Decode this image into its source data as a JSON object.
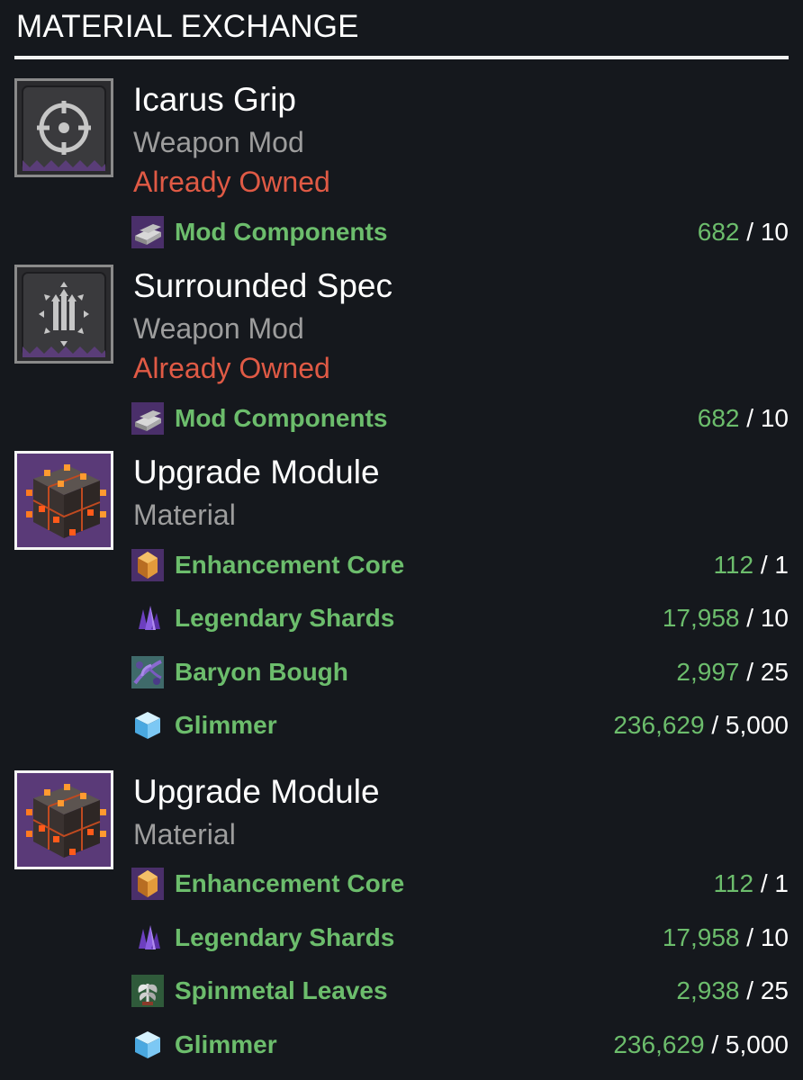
{
  "header": {
    "title": "MATERIAL EXCHANGE"
  },
  "items": [
    {
      "name": "Icarus Grip",
      "type": "Weapon Mod",
      "status": "Already Owned",
      "icon": "crosshair-mod-icon",
      "costs": [
        {
          "name": "Mod Components",
          "have": "682",
          "sep": " / ",
          "need": "10",
          "icon": "mod-components-icon"
        }
      ]
    },
    {
      "name": "Surrounded Spec",
      "type": "Weapon Mod",
      "status": "Already Owned",
      "icon": "surrounded-mod-icon",
      "costs": [
        {
          "name": "Mod Components",
          "have": "682",
          "sep": " / ",
          "need": "10",
          "icon": "mod-components-icon"
        }
      ]
    },
    {
      "name": "Upgrade Module",
      "type": "Material",
      "costs": [
        {
          "name": "Enhancement Core",
          "have": "112",
          "sep": " / ",
          "need": "1",
          "icon": "enhancement-core-icon"
        },
        {
          "name": "Legendary Shards",
          "have": "17,958",
          "sep": " / ",
          "need": "10",
          "icon": "legendary-shards-icon"
        },
        {
          "name": "Baryon Bough",
          "have": "2,997",
          "sep": " / ",
          "need": "25",
          "icon": "baryon-bough-icon"
        },
        {
          "name": "Glimmer",
          "have": "236,629",
          "sep": " / ",
          "need": "5,000",
          "icon": "glimmer-icon"
        }
      ]
    },
    {
      "name": "Upgrade Module",
      "type": "Material",
      "costs": [
        {
          "name": "Enhancement Core",
          "have": "112",
          "sep": " / ",
          "need": "1",
          "icon": "enhancement-core-icon"
        },
        {
          "name": "Legendary Shards",
          "have": "17,958",
          "sep": " / ",
          "need": "10",
          "icon": "legendary-shards-icon"
        },
        {
          "name": "Spinmetal Leaves",
          "have": "2,938",
          "sep": " / ",
          "need": "25",
          "icon": "spinmetal-leaves-icon"
        },
        {
          "name": "Glimmer",
          "have": "236,629",
          "sep": " / ",
          "need": "5,000",
          "icon": "glimmer-icon"
        }
      ]
    }
  ],
  "colors": {
    "background": "#15181d",
    "cost_green": "#6cbd6c",
    "owned_red": "#e05a45",
    "subtitle_gray": "#9d9d9d"
  }
}
